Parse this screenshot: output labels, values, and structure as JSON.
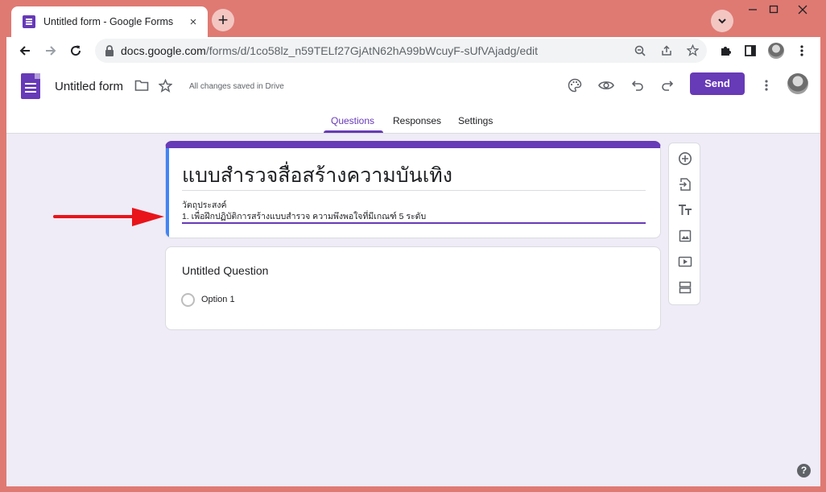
{
  "browser": {
    "tab_title": "Untitled form - Google Forms",
    "tab_close": "×",
    "new_tab": "+",
    "url_host": "docs.google.com",
    "url_path": "/forms/d/1co58lz_n59TELf27GjAtN62hA99bWcuyF-sUfVAjadg/edit"
  },
  "header": {
    "doc_title": "Untitled form",
    "saved_status": "All changes saved in Drive",
    "send_label": "Send",
    "accent": "#673ab7"
  },
  "tabs": [
    {
      "label": "Questions",
      "active": true
    },
    {
      "label": "Responses",
      "active": false
    },
    {
      "label": "Settings",
      "active": false
    }
  ],
  "form": {
    "title": "แบบสำรวจสื่อสร้างความบันเทิง",
    "description_line1": "วัตถุประสงค์",
    "description_line2": "1. เพื่อฝึกปฏิบัติการสร้างแบบสำรวจ ความพึงพอใจที่มีเกณฑ์ 5 ระดับ"
  },
  "question": {
    "title": "Untitled Question",
    "option1": "Option 1"
  },
  "side_tools": [
    "add-question-icon",
    "import-questions-icon",
    "add-title-icon",
    "add-image-icon",
    "add-video-icon",
    "add-section-icon"
  ],
  "help": "?"
}
